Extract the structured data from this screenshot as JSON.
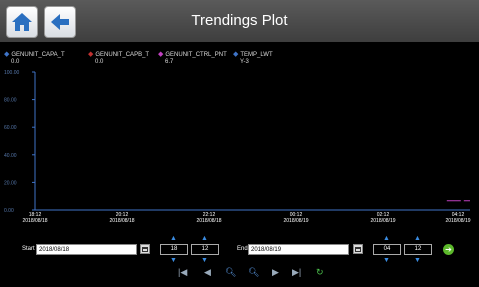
{
  "header": {
    "title": "Trendings Plot"
  },
  "legend": [
    {
      "name": "GENUNIT_CAPA_T",
      "value": "0.0",
      "color": "#3f74c8"
    },
    {
      "name": "GENUNIT_CAPB_T",
      "value": "0.0",
      "color": "#c03030"
    },
    {
      "name": "GENUNIT_CTRL_PNT",
      "value": "6.7",
      "color": "#c040c0"
    },
    {
      "name": "TEMP_LWT",
      "value": "Y-3",
      "color": "#3f74c8"
    }
  ],
  "chart_data": {
    "type": "line",
    "y_tick_labels": [
      "100.00",
      "80.00",
      "60.00",
      "40.00",
      "20.00",
      "0.00"
    ],
    "x_tick_labels": [
      {
        "time": "18:12",
        "date": "2018/08/18"
      },
      {
        "time": "20:12",
        "date": "2018/08/18"
      },
      {
        "time": "22:12",
        "date": "2018/08/18"
      },
      {
        "time": "00:12",
        "date": "2018/08/19"
      },
      {
        "time": "02:12",
        "date": "2018/08/19"
      },
      {
        "time": "04:12",
        "date": "2018/08/19"
      }
    ],
    "ylim": [
      0,
      100
    ],
    "xlim": [
      "2018/08/18 18:12",
      "2018/08/19 04:12"
    ],
    "series": [
      {
        "name": "GENUNIT_CTRL_PNT",
        "color": "#c040c0",
        "points": [
          {
            "x": "2018/08/19 03:40",
            "y": 6.7
          },
          {
            "x": "2018/08/19 04:12",
            "y": 6.7
          }
        ]
      }
    ],
    "grid": false
  },
  "controls": {
    "start_label": "Start",
    "start_date": "2018/08/18",
    "start_hour": "18",
    "start_min": "12",
    "end_label": "End",
    "end_date": "2018/08/19",
    "end_hour": "04",
    "end_min": "12"
  }
}
